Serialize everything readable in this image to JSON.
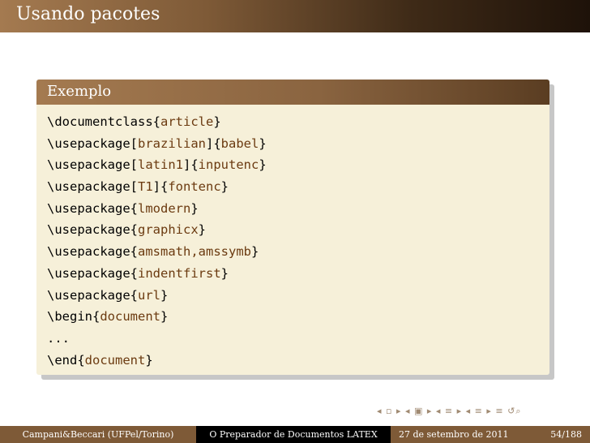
{
  "slide": {
    "title": "Usando pacotes"
  },
  "block": {
    "title": "Exemplo",
    "lines": [
      [
        {
          "t": "cmd",
          "v": "\\documentclass"
        },
        {
          "t": "br",
          "v": "{"
        },
        {
          "t": "arg",
          "v": "article"
        },
        {
          "t": "br",
          "v": "}"
        }
      ],
      [
        {
          "t": "cmd",
          "v": "\\usepackage"
        },
        {
          "t": "br",
          "v": "["
        },
        {
          "t": "arg",
          "v": "brazilian"
        },
        {
          "t": "br",
          "v": "]{"
        },
        {
          "t": "arg",
          "v": "babel"
        },
        {
          "t": "br",
          "v": "}"
        }
      ],
      [
        {
          "t": "cmd",
          "v": "\\usepackage"
        },
        {
          "t": "br",
          "v": "["
        },
        {
          "t": "arg",
          "v": "latin1"
        },
        {
          "t": "br",
          "v": "]{"
        },
        {
          "t": "arg",
          "v": "inputenc"
        },
        {
          "t": "br",
          "v": "}"
        }
      ],
      [
        {
          "t": "cmd",
          "v": "\\usepackage"
        },
        {
          "t": "br",
          "v": "["
        },
        {
          "t": "arg",
          "v": "T1"
        },
        {
          "t": "br",
          "v": "]{"
        },
        {
          "t": "arg",
          "v": "fontenc"
        },
        {
          "t": "br",
          "v": "}"
        }
      ],
      [
        {
          "t": "cmd",
          "v": "\\usepackage"
        },
        {
          "t": "br",
          "v": "{"
        },
        {
          "t": "arg",
          "v": "lmodern"
        },
        {
          "t": "br",
          "v": "}"
        }
      ],
      [
        {
          "t": "cmd",
          "v": "\\usepackage"
        },
        {
          "t": "br",
          "v": "{"
        },
        {
          "t": "arg",
          "v": "graphicx"
        },
        {
          "t": "br",
          "v": "}"
        }
      ],
      [
        {
          "t": "cmd",
          "v": "\\usepackage"
        },
        {
          "t": "br",
          "v": "{"
        },
        {
          "t": "arg",
          "v": "amsmath,amssymb"
        },
        {
          "t": "br",
          "v": "}"
        }
      ],
      [
        {
          "t": "cmd",
          "v": "\\usepackage"
        },
        {
          "t": "br",
          "v": "{"
        },
        {
          "t": "arg",
          "v": "indentfirst"
        },
        {
          "t": "br",
          "v": "}"
        }
      ],
      [
        {
          "t": "cmd",
          "v": "\\usepackage"
        },
        {
          "t": "br",
          "v": "{"
        },
        {
          "t": "arg",
          "v": "url"
        },
        {
          "t": "br",
          "v": "}"
        }
      ],
      [
        {
          "t": "cmd",
          "v": "\\begin"
        },
        {
          "t": "br",
          "v": "{"
        },
        {
          "t": "arg",
          "v": "document"
        },
        {
          "t": "br",
          "v": "}"
        }
      ],
      [
        {
          "t": "cmd",
          "v": "..."
        }
      ],
      [
        {
          "t": "cmd",
          "v": "\\end"
        },
        {
          "t": "br",
          "v": "{"
        },
        {
          "t": "arg",
          "v": "document"
        },
        {
          "t": "br",
          "v": "}"
        }
      ]
    ]
  },
  "navigation": {
    "symbols": "◂ ▫ ▸ ◂ ▣ ▸ ◂ ≡ ▸ ◂ ≡ ▸ ≡ ↺⌕"
  },
  "footer": {
    "author": "Campani&Beccari (UFPel/Torino)",
    "title": "O Preparador de Documentos LATEX",
    "date": "27 de setembro de 2011",
    "page": "54/188"
  },
  "colors": {
    "accent": "#7e5a37",
    "block_body": "#f6f0d9",
    "argument": "#6b3a10"
  }
}
